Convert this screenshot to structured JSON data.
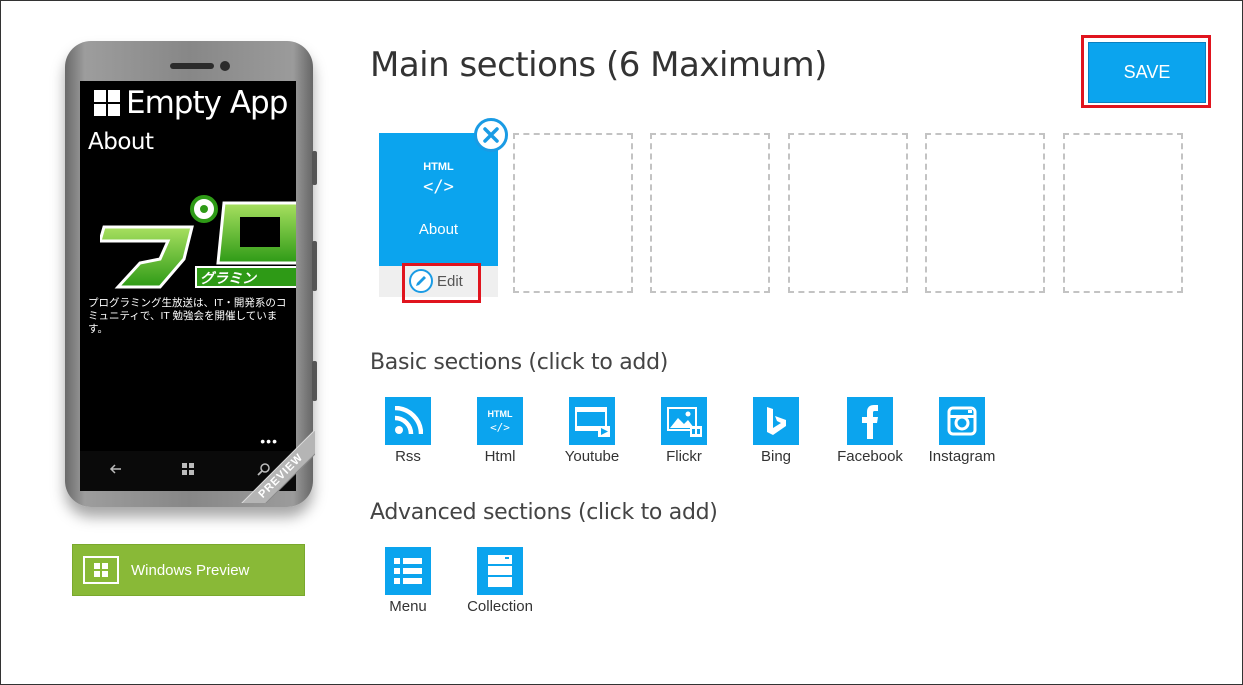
{
  "phone": {
    "app_title": "Empty App",
    "page_name": "About",
    "about_text": "プログラミング生放送は、IT・開発系のコミュニティで、IT 勉強会を開催しています。",
    "hero_lettering": "プロ グラミン",
    "ribbon": "PREVIEW",
    "more_dots": "•••"
  },
  "windows_preview": {
    "label": "Windows Preview"
  },
  "main": {
    "title": "Main sections (6 Maximum)",
    "save_label": "SAVE",
    "tile": {
      "html_tag": "HTML",
      "code_tag": "</>",
      "label": "About",
      "edit_label": "Edit"
    }
  },
  "basic": {
    "title": "Basic sections (click to add)",
    "items": [
      {
        "label": "Rss",
        "icon": "rss-icon"
      },
      {
        "label": "Html",
        "icon": "html-icon"
      },
      {
        "label": "Youtube",
        "icon": "youtube-icon"
      },
      {
        "label": "Flickr",
        "icon": "flickr-icon"
      },
      {
        "label": "Bing",
        "icon": "bing-icon"
      },
      {
        "label": "Facebook",
        "icon": "facebook-icon"
      },
      {
        "label": "Instagram",
        "icon": "instagram-icon"
      }
    ]
  },
  "advanced": {
    "title": "Advanced sections (click to add)",
    "items": [
      {
        "label": "Menu",
        "icon": "menu-icon"
      },
      {
        "label": "Collection",
        "icon": "collection-icon"
      }
    ]
  },
  "colors": {
    "accent": "#0ba4ee",
    "highlight": "#e0141e",
    "preview_green": "#89b937"
  }
}
